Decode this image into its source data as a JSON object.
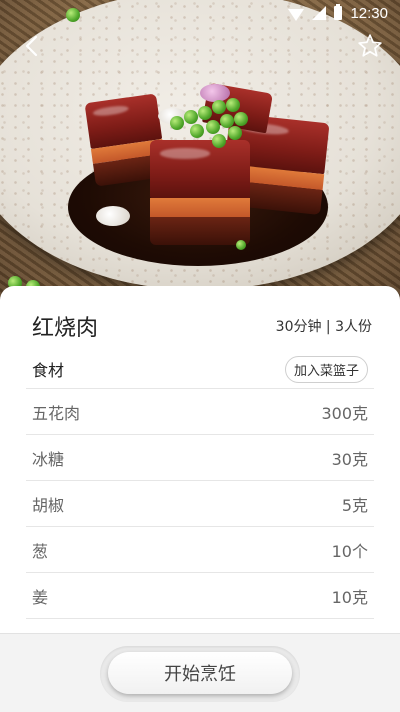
{
  "status_bar": {
    "time": "12:30"
  },
  "nav": {
    "back_icon": "chevron-left-icon",
    "favorite_icon": "star-outline-icon"
  },
  "recipe": {
    "title": "红烧肉",
    "meta": "30分钟 | 3人份"
  },
  "ingredients_section": {
    "label": "食材",
    "add_to_basket_label": "加入菜篮子",
    "items": [
      {
        "name": "五花肉",
        "amount": "300克"
      },
      {
        "name": "冰糖",
        "amount": "30克"
      },
      {
        "name": "胡椒",
        "amount": "5克"
      },
      {
        "name": "葱",
        "amount": "10个"
      },
      {
        "name": "姜",
        "amount": "10克"
      }
    ]
  },
  "footer": {
    "start_label": "开始烹饪"
  },
  "colors": {
    "card_bg": "#ffffff",
    "page_bg": "#f3f3f3",
    "text_primary": "#222222",
    "text_secondary": "#666666"
  }
}
